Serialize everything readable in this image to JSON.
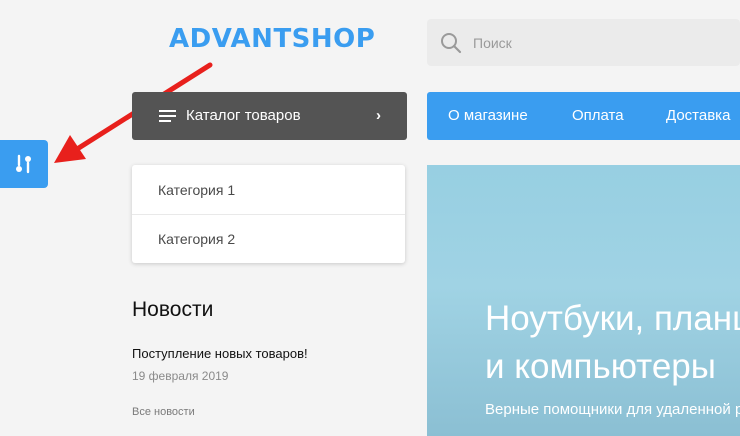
{
  "header": {
    "logo": "ADVANTSHOP",
    "search": {
      "placeholder": "Поиск",
      "value": ""
    }
  },
  "sidebar_tool": {
    "icon": "settings-sliders-icon",
    "color": "#3a9df0"
  },
  "annotation": {
    "icon": "red-arrow-icon",
    "color": "#e8201c"
  },
  "catalog": {
    "label": "Каталог товаров",
    "chevron": "›"
  },
  "nav": {
    "items": [
      "О магазине",
      "Оплата",
      "Доставка"
    ]
  },
  "categories": {
    "items": [
      "Категория 1",
      "Категория 2"
    ]
  },
  "news": {
    "title": "Новости",
    "item_title": "Поступление новых товаров!",
    "item_date": "19 февраля 2019",
    "all_link": "Все новости"
  },
  "banner": {
    "line1": "Ноутбуки, планшеты",
    "line2": "и компьютеры",
    "subtitle": "Верные помощники для удаленной работы"
  },
  "colors": {
    "accent": "#3a9df0",
    "catalog_bg": "#545454",
    "page_bg": "#f4f4f4"
  }
}
